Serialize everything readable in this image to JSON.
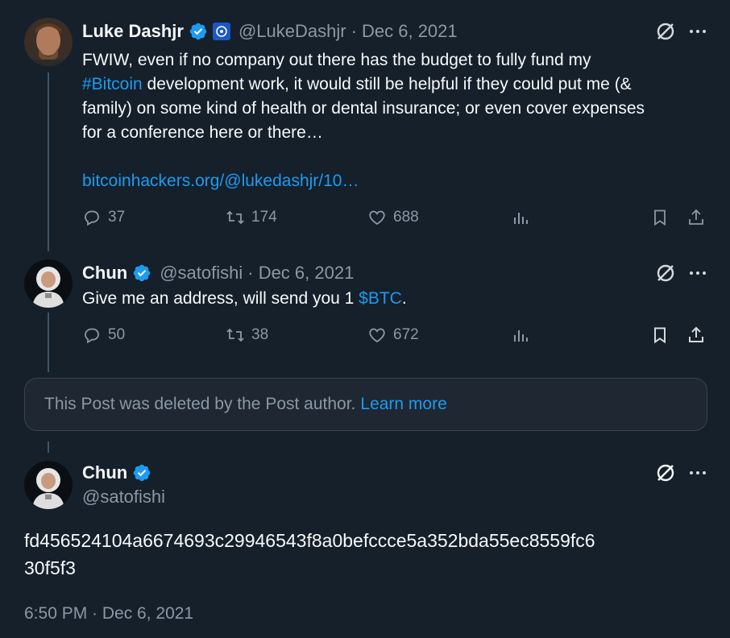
{
  "tweets": [
    {
      "name": "Luke Dashjr",
      "handle": "@LukeDashjr",
      "date": "· Dec 6, 2021",
      "text_lines": [
        {
          "pre": "FWIW, even if no company out there has the budget to fully fund my",
          "hashtag": "",
          "post": ""
        },
        {
          "pre": "",
          "hashtag": "#Bitcoin",
          "post": " development work, it would still be helpful if they could put me (&"
        },
        {
          "pre": "family) on some kind of health or dental insurance; or even cover expenses",
          "hashtag": "",
          "post": ""
        },
        {
          "pre": "for a conference here or there…",
          "hashtag": "",
          "post": ""
        }
      ],
      "link": "bitcoinhackers.org/@lukedashjr/10…",
      "replies": "37",
      "reposts": "174",
      "likes": "688"
    },
    {
      "name": "Chun",
      "handle": "@satofishi",
      "date": "· Dec 6, 2021",
      "text_pre": "Give me an address, will send you 1 ",
      "cashtag": "$BTC",
      "text_post": ".",
      "replies": "50",
      "reposts": "38",
      "likes": "672"
    }
  ],
  "deleted_notice": {
    "text": "This Post was deleted by the Post author.",
    "link": "Learn more"
  },
  "main_tweet": {
    "name": "Chun",
    "handle": "@satofishi",
    "text_line1": "fd456524104a6674693c29946543f8a0befccce5a352bda55ec8559fc6",
    "text_line2": "30f5f3",
    "timestamp": "6:50 PM · Dec 6, 2021"
  },
  "colors": {
    "background": "#15202b",
    "accent": "#1d9bf0",
    "muted": "#8b98a5",
    "verified": "#1d9bf0"
  },
  "icons": [
    "grok-icon",
    "more-icon",
    "reply-icon",
    "repost-icon",
    "like-icon",
    "views-icon",
    "bookmark-icon",
    "share-icon",
    "verified-badge-icon"
  ]
}
